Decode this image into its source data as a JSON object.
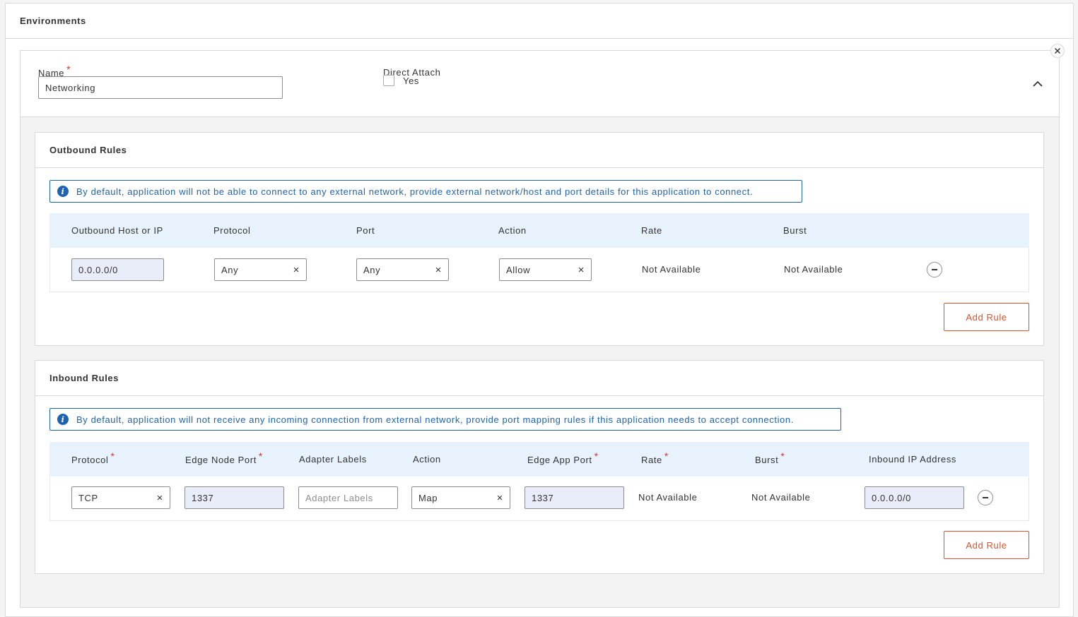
{
  "section": {
    "title": "Environments"
  },
  "environment": {
    "name_label": "Name",
    "name_value": "Networking",
    "direct_attach_label": "Direct Attach",
    "direct_attach_option": "Yes",
    "close_icon": "close-icon",
    "collapse_icon": "chevron-up-icon"
  },
  "outbound": {
    "title": "Outbound Rules",
    "info": "By default, application will not be able to connect to any external network, provide external network/host and port details for this application to connect.",
    "columns": [
      "Outbound Host or IP",
      "Protocol",
      "Port",
      "Action",
      "Rate",
      "Burst"
    ],
    "row": {
      "host": "0.0.0.0/0",
      "protocol": "Any",
      "port": "Any",
      "action": "Allow",
      "rate": "Not Available",
      "burst": "Not Available"
    },
    "add_label": "Add Rule"
  },
  "inbound": {
    "title": "Inbound Rules",
    "info": "By default, application will not receive any incoming connection from external network, provide port mapping rules if this application needs to accept connection.",
    "columns": [
      "Protocol",
      "Edge Node Port",
      "Adapter Labels",
      "Action",
      "Edge App Port",
      "Rate",
      "Burst",
      "Inbound IP Address"
    ],
    "row": {
      "protocol": "TCP",
      "edge_node_port": "1337",
      "adapter_labels_placeholder": "Adapter Labels",
      "action": "Map",
      "edge_app_port": "1337",
      "rate": "Not Available",
      "burst": "Not Available",
      "inbound_ip": "0.0.0.0/0"
    },
    "add_label": "Add Rule"
  },
  "colors": {
    "accent": "#d9532c",
    "info": "#1f63b0",
    "required": "#d9342b",
    "table_header": "#e8f2fd",
    "filled_input": "#e8edf9"
  }
}
